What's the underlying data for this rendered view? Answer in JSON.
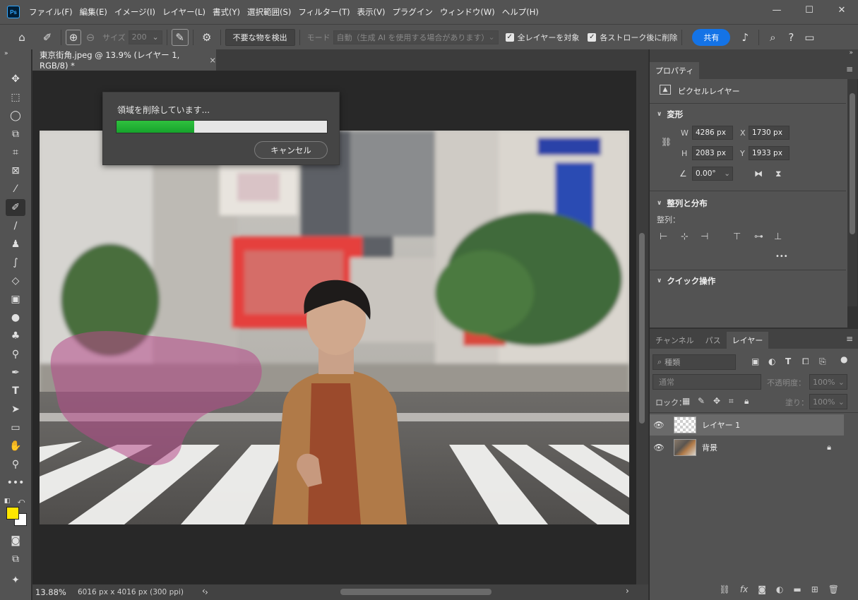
{
  "app": {
    "logo": "Ps",
    "menu": [
      "ファイル(F)",
      "編集(E)",
      "イメージ(I)",
      "レイヤー(L)",
      "書式(Y)",
      "選択範囲(S)",
      "フィルター(T)",
      "表示(V)",
      "プラグイン",
      "ウィンドウ(W)",
      "ヘルプ(H)"
    ],
    "window_controls": {
      "minimize": "—",
      "maximize": "☐",
      "close": "✕"
    }
  },
  "options": {
    "size_label": "サイズ",
    "size_value": "200",
    "detect_button": "不要な物を検出",
    "mode_label": "モード",
    "mode_value": "自動（生成 AI を使用する場合があります）",
    "all_layers_label": "全レイヤーを対象",
    "delete_after_stroke_label": "各ストローク後に削除",
    "share_label": "共有"
  },
  "document": {
    "tab_title": "東京街角.jpeg @ 13.9% (レイヤー 1, RGB/8) *",
    "close": "×",
    "zoom": "13.88%",
    "info": "6016 px x 4016 px (300 ppi)"
  },
  "progress": {
    "title": "領域を削除しています...",
    "value": 0.37,
    "cancel_label": "キャンセル"
  },
  "properties": {
    "tab": "プロパティ",
    "layer_type": "ピクセルレイヤー",
    "transform": {
      "title": "変形",
      "w_label": "W",
      "w_value": "4286 px",
      "h_label": "H",
      "h_value": "2083 px",
      "x_label": "X",
      "x_value": "1730 px",
      "y_label": "Y",
      "y_value": "1933 px",
      "angle_value": "0.00°"
    },
    "align": {
      "title": "整列と分布",
      "label": "整列：",
      "more": "•••"
    },
    "quick_actions": {
      "title": "クイック操作"
    }
  },
  "layers_panel": {
    "tabs": [
      "チャンネル",
      "パス",
      "レイヤー"
    ],
    "active_tab": "レイヤー",
    "filter_placeholder": "種類",
    "blend_mode": "通常",
    "opacity_label": "不透明度：",
    "opacity_value": "100%",
    "lock_label": "ロック：",
    "fill_label": "塗り：",
    "fill_value": "100%",
    "layers": [
      {
        "name": "レイヤー 1",
        "selected": true,
        "locked": false
      },
      {
        "name": "背景",
        "selected": false,
        "locked": true
      }
    ]
  },
  "colors": {
    "foreground": "#ffe600",
    "background": "#ffffff",
    "accent": "#1473e6",
    "progress": "#22b236"
  }
}
